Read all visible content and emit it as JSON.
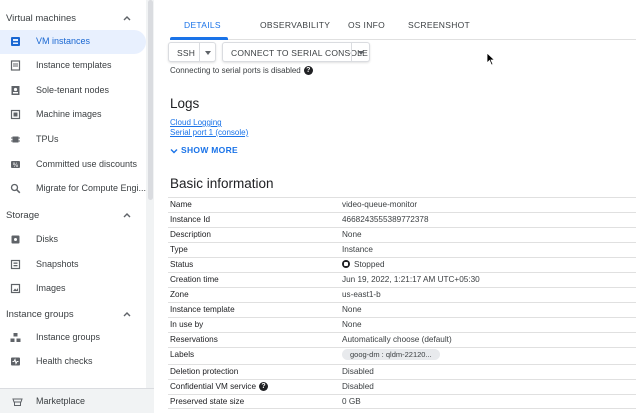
{
  "sidebar": {
    "sections": [
      {
        "label": "Virtual machines"
      },
      {
        "label": "Storage"
      },
      {
        "label": "Instance groups"
      }
    ],
    "vm_items": [
      {
        "label": "VM instances",
        "icon": "vm-instance-icon"
      },
      {
        "label": "Instance templates",
        "icon": "template-icon"
      },
      {
        "label": "Sole-tenant nodes",
        "icon": "sole-tenant-icon"
      },
      {
        "label": "Machine images",
        "icon": "machine-image-icon"
      },
      {
        "label": "TPUs",
        "icon": "tpu-icon"
      },
      {
        "label": "Committed use discounts",
        "icon": "discount-icon"
      },
      {
        "label": "Migrate for Compute Engi...",
        "icon": "migrate-icon"
      }
    ],
    "storage_items": [
      {
        "label": "Disks",
        "icon": "disk-icon"
      },
      {
        "label": "Snapshots",
        "icon": "snapshot-icon"
      },
      {
        "label": "Images",
        "icon": "image-icon"
      }
    ],
    "group_items": [
      {
        "label": "Instance groups",
        "icon": "instance-groups-icon"
      },
      {
        "label": "Health checks",
        "icon": "health-check-icon"
      }
    ],
    "bottom": {
      "label": "Marketplace",
      "icon": "marketplace-icon"
    }
  },
  "tabs": [
    "DETAILS",
    "OBSERVABILITY",
    "OS INFO",
    "SCREENSHOT"
  ],
  "toolbar": {
    "ssh_label": "SSH",
    "serial_label": "CONNECT TO SERIAL CONSOLE",
    "serial_note": "Connecting to serial ports is disabled"
  },
  "logs": {
    "title": "Logs",
    "links": [
      "Cloud Logging",
      "Serial port 1 (console)"
    ],
    "show_more": "SHOW MORE"
  },
  "basic_info": {
    "title": "Basic information",
    "rows": [
      {
        "key": "Name",
        "value": "video-queue-monitor"
      },
      {
        "key": "Instance Id",
        "value": "4668243555389772378"
      },
      {
        "key": "Description",
        "value": "None"
      },
      {
        "key": "Type",
        "value": "Instance"
      },
      {
        "key": "Status",
        "value": "Stopped"
      },
      {
        "key": "Creation time",
        "value": "Jun 19, 2022, 1:21:17 AM UTC+05:30"
      },
      {
        "key": "Zone",
        "value": "us-east1-b"
      },
      {
        "key": "Instance template",
        "value": "None"
      },
      {
        "key": "In use by",
        "value": "None"
      },
      {
        "key": "Reservations",
        "value": "Automatically choose (default)"
      },
      {
        "key": "Labels",
        "value": "goog-dm : qldm-22120..."
      },
      {
        "key": "Deletion protection",
        "value": "Disabled"
      },
      {
        "key": "Confidential VM service",
        "value": "Disabled"
      },
      {
        "key": "Preserved state size",
        "value": "0 GB"
      }
    ]
  },
  "colors": {
    "accent": "#1a73e8",
    "active_bg": "#e8f0fe"
  }
}
